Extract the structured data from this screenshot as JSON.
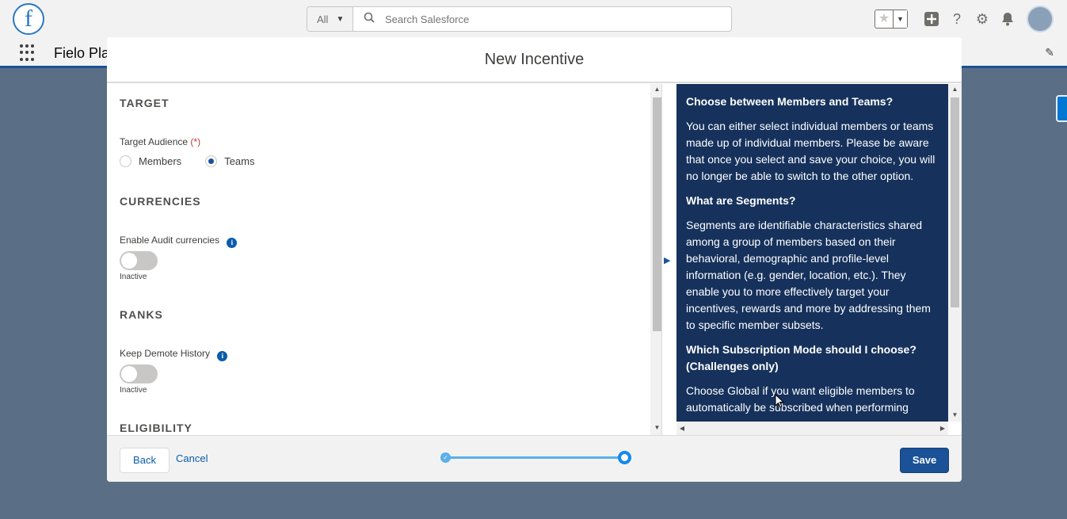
{
  "app": {
    "logo_letter": "f",
    "name": "Fielo Pla"
  },
  "search": {
    "scope": "All",
    "placeholder": "Search Salesforce"
  },
  "modal": {
    "title": "New Incentive"
  },
  "form": {
    "target": {
      "section_title": "TARGET",
      "audience_label": "Target Audience",
      "required_marker": "(*)",
      "options": [
        "Members",
        "Teams"
      ],
      "selected": "Teams"
    },
    "currencies": {
      "section_title": "CURRENCIES",
      "audit_label": "Enable Audit currencies",
      "audit_state": "Inactive"
    },
    "ranks": {
      "section_title": "RANKS",
      "demote_label": "Keep Demote History",
      "demote_state": "Inactive"
    },
    "eligibility": {
      "section_title": "ELIGIBILITY"
    }
  },
  "help": {
    "items": [
      {
        "question": "Choose between Members and Teams?",
        "answer": "You can either select individual members or teams made up of individual members. Please be aware that once you select and save your choice, you will no longer be able to switch to the other option."
      },
      {
        "question": "What are Segments?",
        "answer": "Segments are identifiable characteristics shared among a group of members based on their behavioral, demographic and profile-level information (e.g. gender, location, etc.). They enable you to more effectively target your incentives, rewards and more by addressing them to specific member subsets."
      },
      {
        "question": "Which Subscription Mode should I choose? (Challenges only)",
        "answer": "Choose Global if you want eligible members to automatically be subscribed when performing"
      }
    ]
  },
  "footer": {
    "back_label": "Back",
    "cancel_label": "Cancel",
    "save_label": "Save",
    "progress_percent": 100
  },
  "colors": {
    "brand": "#1b5297",
    "help_bg": "#16325c",
    "link": "#0b5cab",
    "progress": "#5ab0ea"
  },
  "icons": {
    "search": "search-icon",
    "favorites": "star-icon",
    "add": "plus-icon",
    "help": "question-icon",
    "setup": "gear-icon",
    "notifications": "bell-icon",
    "edit": "pencil-icon"
  }
}
